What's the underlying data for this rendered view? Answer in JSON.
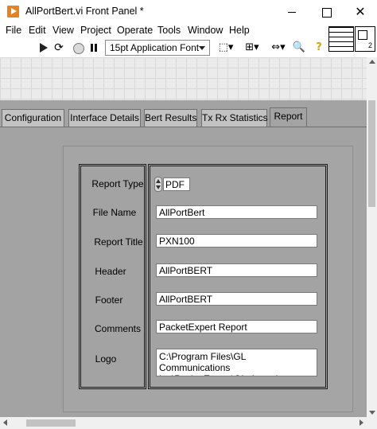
{
  "window": {
    "title": "AllPortBert.vi Front Panel *",
    "minimize_glyph": "",
    "maximize_glyph": "",
    "close_glyph": "✕"
  },
  "menu": [
    "File",
    "Edit",
    "View",
    "Project",
    "Operate",
    "Tools",
    "Window",
    "Help"
  ],
  "toolbar": {
    "run_continuously_glyph": "⟳",
    "font_select": "15pt Application Font",
    "align_glyph": "⬚▾",
    "distribute_glyph": "⊞▾",
    "resize_glyph": "⇔▾",
    "search_glyph": "🔍",
    "help_glyph": "?",
    "icons": [
      "run-arrow-icon",
      "run-continuously-icon",
      "abort-icon",
      "pause-icon",
      "align-objects-icon",
      "distribute-objects-icon",
      "resize-objects-icon",
      "search-icon",
      "context-help-icon"
    ]
  },
  "tabs": [
    {
      "label": "Configuration",
      "active": false
    },
    {
      "label": "Interface Details",
      "active": false
    },
    {
      "label": "Bert Results",
      "active": false
    },
    {
      "label": "Tx Rx Statistics",
      "active": false
    },
    {
      "label": "Report",
      "active": true
    }
  ],
  "report": {
    "report_type": {
      "label": "Report Type",
      "value": "PDF"
    },
    "file_name": {
      "label": "File Name",
      "value": "AllPortBert"
    },
    "report_title": {
      "label": "Report Title",
      "value": "PXN100"
    },
    "header": {
      "label": "Header",
      "value": "AllPortBERT"
    },
    "footer": {
      "label": "Footer",
      "value": "AllPortBERT"
    },
    "comments": {
      "label": "Comments",
      "value": "PacketExpert Report"
    },
    "logo": {
      "label": "Logo",
      "value": "C:\\Program Files\\GL Communications Inc\\PacketExpert\\GL_Logo.jpg"
    }
  },
  "colors": {
    "panel_bg": "#a3a3a3",
    "tab_inactive": "#c2c2c2",
    "app_icon": "#e8821e"
  }
}
